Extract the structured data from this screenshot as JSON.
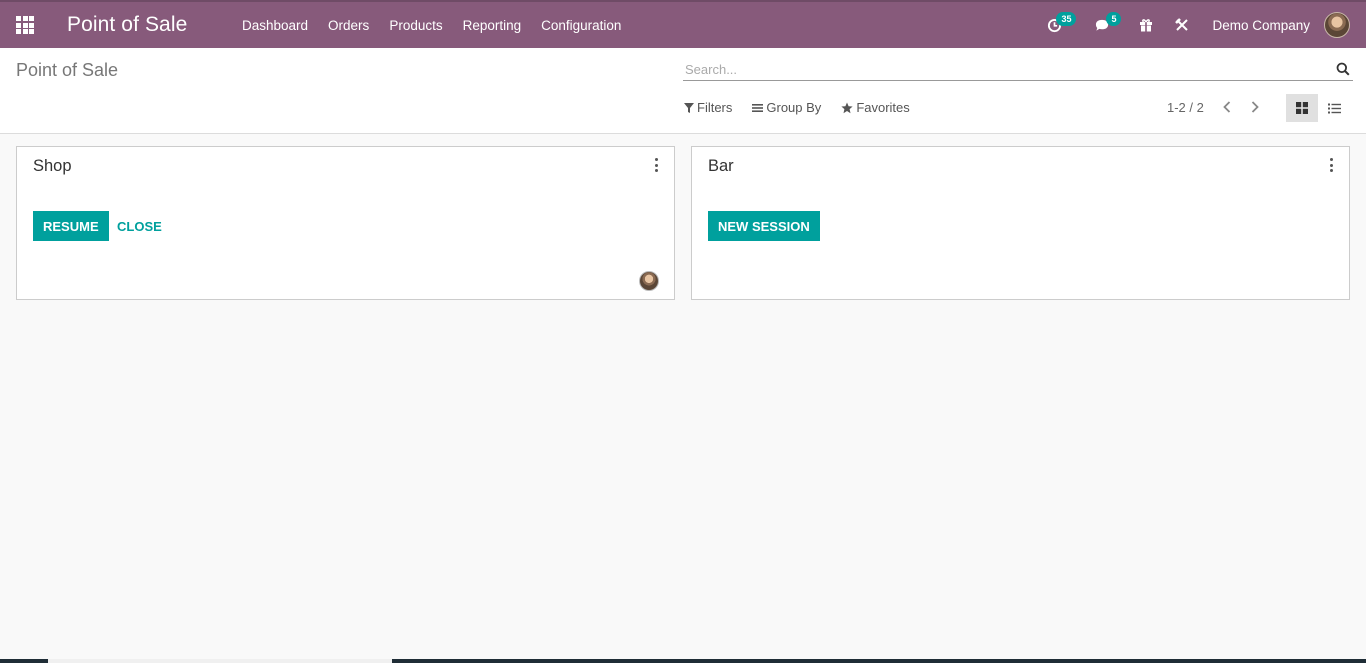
{
  "navbar": {
    "app_title": "Point of Sale",
    "menu": [
      {
        "label": "Dashboard"
      },
      {
        "label": "Orders"
      },
      {
        "label": "Products"
      },
      {
        "label": "Reporting"
      },
      {
        "label": "Configuration"
      }
    ],
    "activity_count": "35",
    "messages_count": "5",
    "company": "Demo Company",
    "icons": [
      "apps-grid-icon",
      "activity-clock-icon",
      "chat-icon",
      "gift-icon",
      "debug-icon",
      "user-avatar"
    ],
    "color": "#875a7b"
  },
  "control_panel": {
    "breadcrumb": "Point of Sale",
    "search_placeholder": "Search...",
    "filters_label": "Filters",
    "groupby_label": "Group By",
    "favorites_label": "Favorites",
    "pager": "1-2 / 2",
    "active_view": "kanban"
  },
  "cards": [
    {
      "title": "Shop",
      "primary_label": "RESUME",
      "secondary_label": "CLOSE",
      "has_avatar": true
    },
    {
      "title": "Bar",
      "primary_label": "NEW SESSION",
      "has_avatar": false
    }
  ],
  "accent_color": "#00a09d"
}
